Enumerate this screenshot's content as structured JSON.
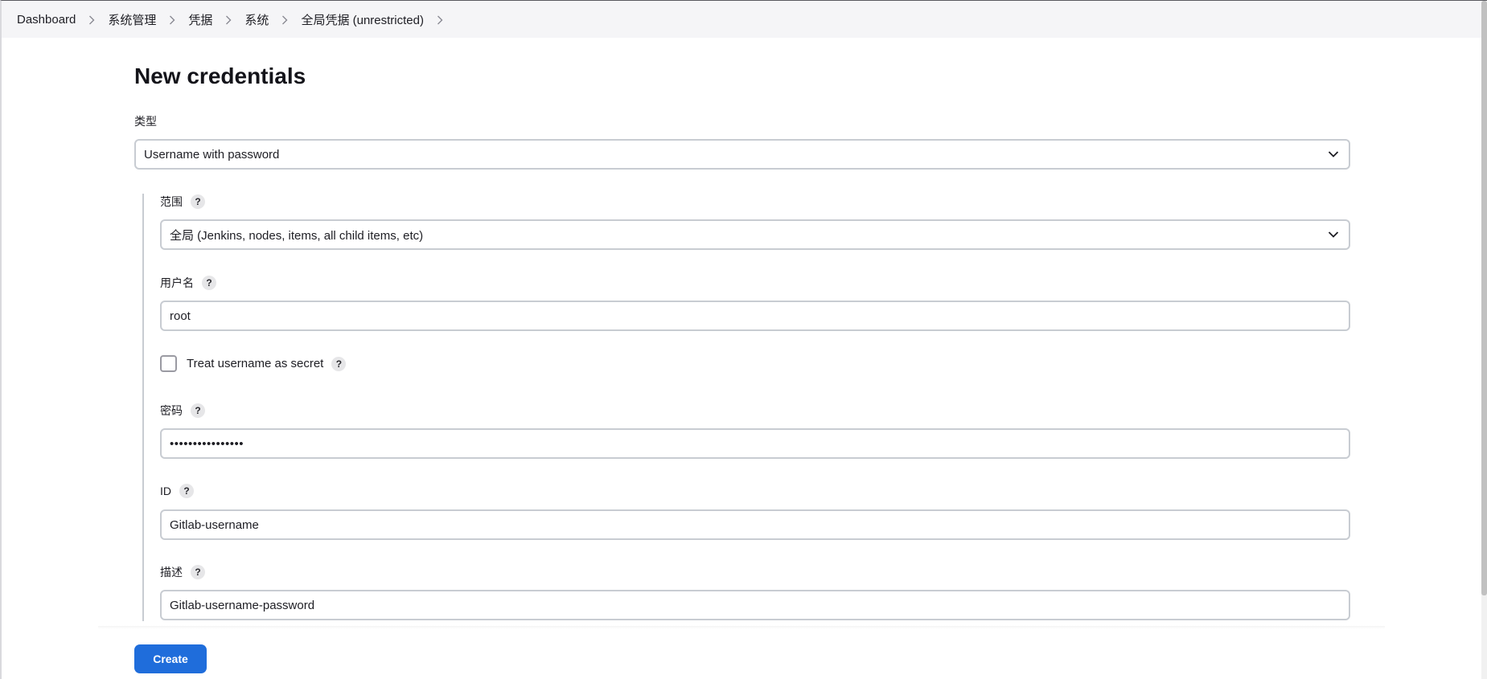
{
  "breadcrumb": {
    "items": [
      {
        "label": "Dashboard"
      },
      {
        "label": "系统管理"
      },
      {
        "label": "凭据"
      },
      {
        "label": "系统"
      },
      {
        "label": "全局凭据 (unrestricted)"
      }
    ]
  },
  "page": {
    "title": "New credentials"
  },
  "form": {
    "kind": {
      "label": "类型",
      "value": "Username with password"
    },
    "scope": {
      "label": "范围",
      "value": "全局 (Jenkins, nodes, items, all child items, etc)"
    },
    "username": {
      "label": "用户名",
      "value": "root"
    },
    "username_secret": {
      "label": "Treat username as secret",
      "checked": false
    },
    "password": {
      "label": "密码",
      "value": "••••••••••••••••"
    },
    "id": {
      "label": "ID",
      "value": "Gitlab-username"
    },
    "description": {
      "label": "描述",
      "value": "Gitlab-username-password"
    }
  },
  "actions": {
    "create_label": "Create",
    "accent_color": "#1f6ddb"
  },
  "help_icon": "?",
  "icons": {
    "breadcrumb_separator": "chevron-right-icon",
    "select_toggle": "chevron-down-icon",
    "help": "help-icon"
  }
}
